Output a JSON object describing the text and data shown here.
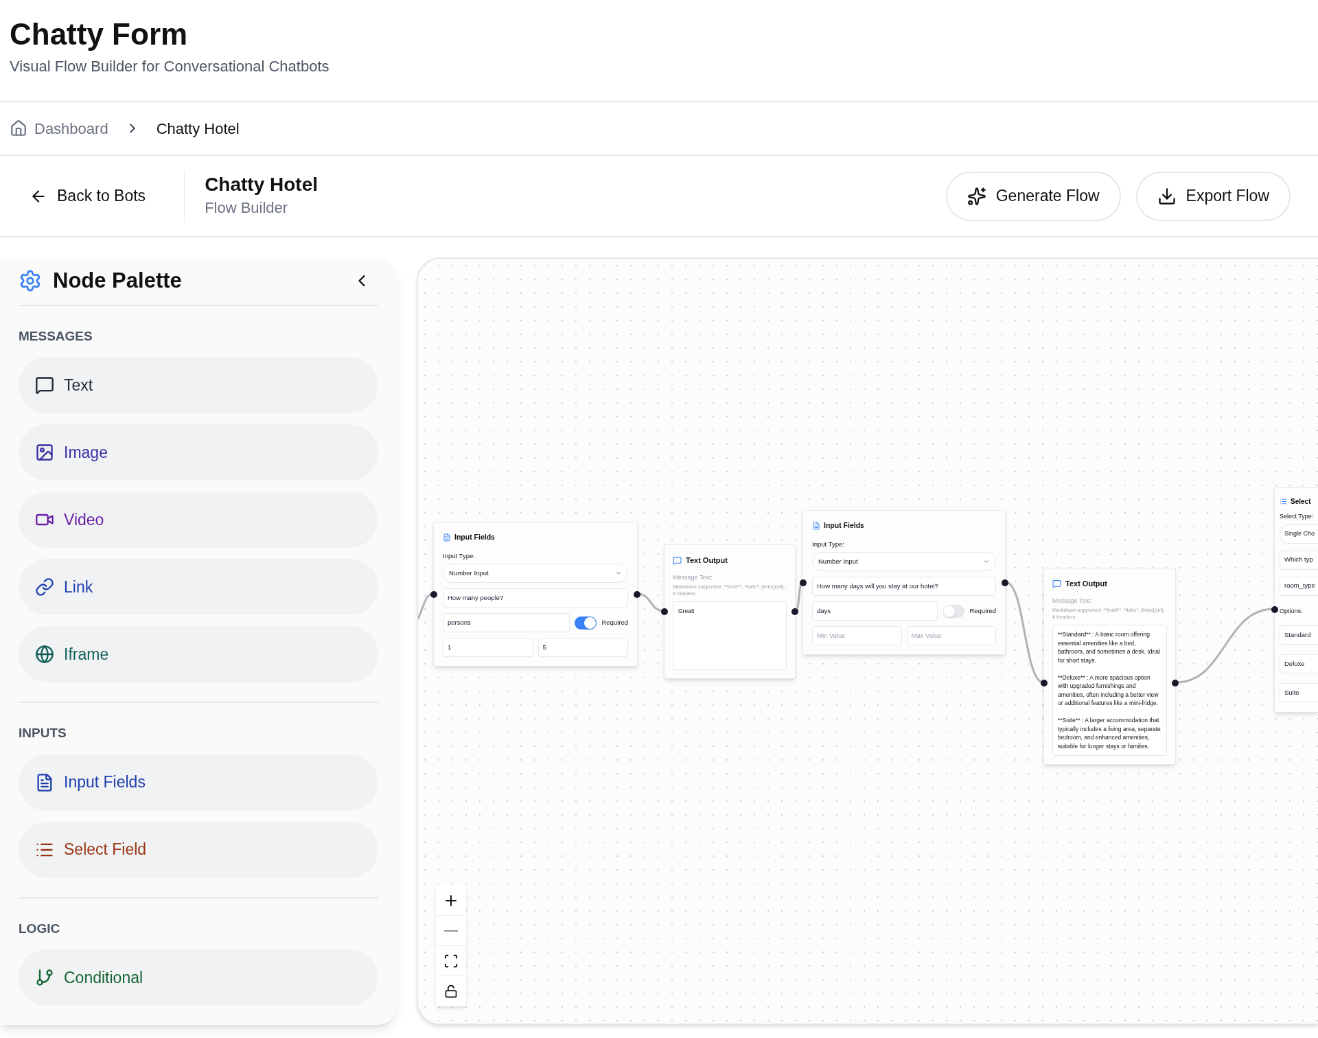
{
  "app": {
    "title": "Chatty Form",
    "subtitle": "Visual Flow Builder for Conversational Chatbots"
  },
  "breadcrumb": [
    {
      "label": "Dashboard"
    },
    {
      "label": "Chatty Hotel"
    }
  ],
  "toolbar": {
    "back": "Back to Bots",
    "title": "Chatty Hotel",
    "subtitle": "Flow Builder",
    "buttons": [
      {
        "label": "Generate Flow"
      },
      {
        "label": "Export Flow"
      }
    ]
  },
  "palette": {
    "title": "Node Palette",
    "sections": [
      {
        "label": "MESSAGES",
        "items": [
          {
            "label": "Text",
            "color": "#1f2937"
          },
          {
            "label": "Image",
            "color": "#3730a3"
          },
          {
            "label": "Video",
            "color": "#6b21a8"
          },
          {
            "label": "Link",
            "color": "#1e40af"
          },
          {
            "label": "Iframe",
            "color": "#115e59"
          }
        ]
      },
      {
        "label": "INPUTS",
        "items": [
          {
            "label": "Input Fields",
            "color": "#1e40af"
          },
          {
            "label": "Select Field",
            "color": "#9a3412"
          }
        ]
      },
      {
        "label": "LOGIC",
        "items": [
          {
            "label": "Conditional",
            "color": "#166534"
          }
        ]
      }
    ]
  },
  "canvas": {
    "nodes": [
      {
        "kind": "input_fields",
        "title": "Input Fields",
        "type_label": "Input Type:",
        "input_type": "Number Input",
        "question": "How many people?",
        "unit": "persons",
        "required": true,
        "required_label": "Required",
        "min": {
          "value": "1"
        },
        "max": {
          "value": "5"
        }
      },
      {
        "kind": "text_output",
        "title": "Text Output",
        "label": "Message Text:",
        "hint": "Markdown supported: **bold**, *italic*, [links](url), # headers",
        "message": "Great!"
      },
      {
        "kind": "input_fields",
        "title": "Input Fields",
        "type_label": "Input Type:",
        "input_type": "Number Input",
        "question": "How many days will you stay at our hotel?",
        "unit": "days",
        "required": false,
        "required_label": "Required",
        "min": {
          "placeholder": "Min Value"
        },
        "max": {
          "placeholder": "Max Value"
        }
      },
      {
        "kind": "text_output",
        "title": "Text Output",
        "label": "Message Text:",
        "hint": "Markdown supported: **bold**, *italic*, [links](url), # headers",
        "message": "**Standard** : A basic room offering essential amenities like a bed, bathroom, and sometimes a desk. Ideal for short stays.\n\n**Deluxe** : A more spacious option with upgraded furnishings and amenities, often including a better view or additional features like a mini-fridge.\n\n**Suite** : A larger accommodation that typically includes a living area, separate bedroom, and enhanced amenities, suitable for longer stays or families."
      },
      {
        "kind": "select",
        "title": "Select",
        "type_label": "Select Type:",
        "select_type": "Single Cho",
        "question": "Which typ",
        "variable": "room_type",
        "options_label": "Options:",
        "options": [
          "Standard",
          "Deluxe",
          "Suite"
        ]
      }
    ]
  }
}
